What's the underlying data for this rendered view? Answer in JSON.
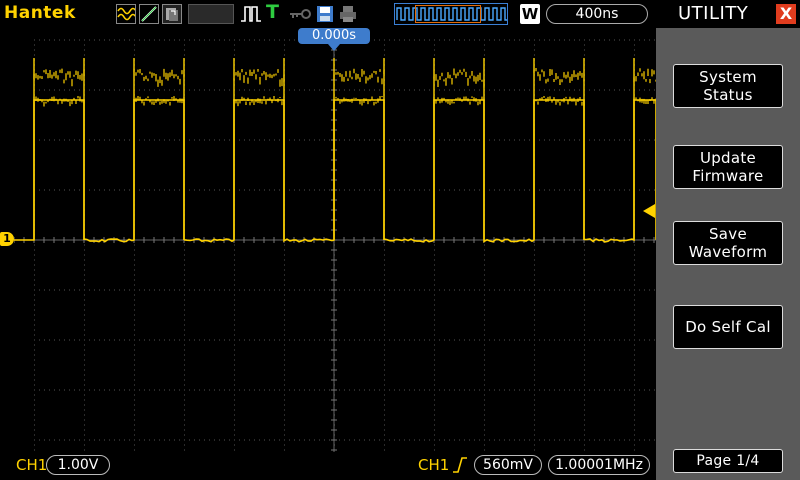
{
  "topbar": {
    "brand": "Hantek",
    "trigger_type_letter": "T",
    "acquire_mode_badge": "W",
    "timebase": "400ns",
    "icons": [
      "wave-icon",
      "slope-icon",
      "stack-icon",
      "pulse-trigger-icon",
      "key-icon",
      "save-disk-icon",
      "printer-icon",
      "waveform-window-icon"
    ]
  },
  "graticule": {
    "horizontal_position": "0.000s",
    "ch1_marker": "1"
  },
  "bottombar": {
    "ch1_label": "CH1",
    "ch1_scale": "1.00V",
    "trigger_source": "CH1",
    "trigger_level": "560mV",
    "frequency": "1.00001MHz"
  },
  "menu": {
    "title": "UTILITY",
    "close": "X",
    "buttons": {
      "system_status": "System\nStatus",
      "update_firmware": "Update\nFirmware",
      "save_waveform": "Save\nWaveform",
      "self_cal": "Do Self Cal",
      "page": "Page 1/4"
    }
  },
  "colors": {
    "trace": "#ffd200",
    "accent_blue": "#3e7ccc",
    "menu_bg": "#5a5a5a",
    "close_red": "#e03c1e"
  }
}
